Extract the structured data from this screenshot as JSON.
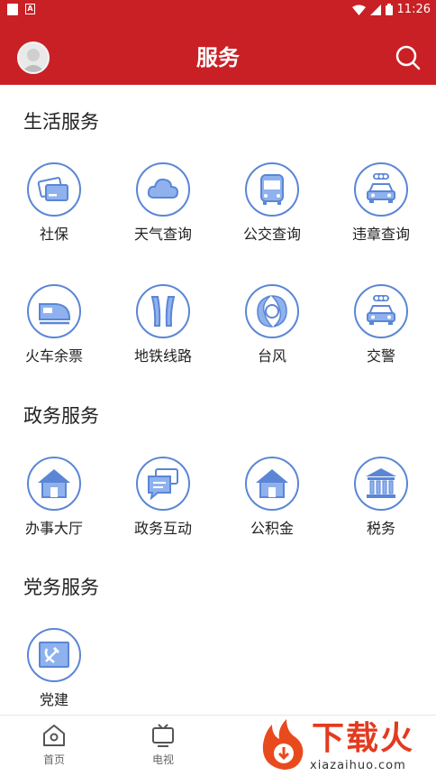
{
  "status_bar": {
    "time": "11:26"
  },
  "header": {
    "title": "服务"
  },
  "sections": {
    "life": {
      "title": "生活服务",
      "items": [
        {
          "label": "社保",
          "icon": "card-icon"
        },
        {
          "label": "天气查询",
          "icon": "cloud-icon"
        },
        {
          "label": "公交查询",
          "icon": "bus-icon"
        },
        {
          "label": "违章查询",
          "icon": "car-signal-icon"
        },
        {
          "label": "火车余票",
          "icon": "train-icon"
        },
        {
          "label": "地铁线路",
          "icon": "subway-icon"
        },
        {
          "label": "台风",
          "icon": "typhoon-icon"
        },
        {
          "label": "交警",
          "icon": "police-car-icon"
        }
      ]
    },
    "gov": {
      "title": "政务服务",
      "items": [
        {
          "label": "办事大厅",
          "icon": "house-icon"
        },
        {
          "label": "政务互动",
          "icon": "chat-icon"
        },
        {
          "label": "公积金",
          "icon": "house-icon"
        },
        {
          "label": "税务",
          "icon": "bank-icon"
        }
      ]
    },
    "party": {
      "title": "党务服务",
      "items": [
        {
          "label": "党建",
          "icon": "party-flag-icon"
        }
      ]
    }
  },
  "bottom_nav": [
    {
      "label": "首页",
      "icon": "home-icon"
    },
    {
      "label": "电视",
      "icon": "tv-icon"
    }
  ],
  "watermark": {
    "text": "下载火",
    "sub": "xiazaihuo.com"
  },
  "colors": {
    "brand_red": "#c92026",
    "icon_blue": "#5b86d6",
    "icon_fill": "#8fb2ee"
  }
}
